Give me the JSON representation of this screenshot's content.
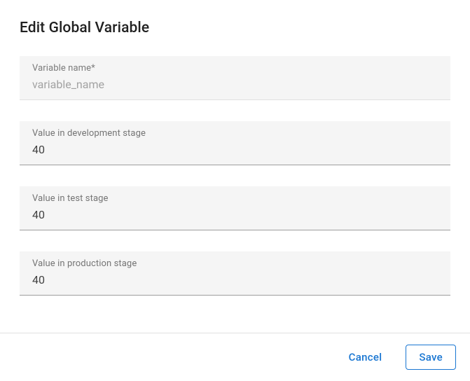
{
  "dialog": {
    "title": "Edit Global Variable"
  },
  "fields": {
    "name": {
      "label": "Variable name*",
      "value": "variable_name"
    },
    "dev": {
      "label": "Value in development stage",
      "value": "40"
    },
    "test": {
      "label": "Value in test stage",
      "value": "40"
    },
    "prod": {
      "label": "Value in production stage",
      "value": "40"
    }
  },
  "actions": {
    "cancel": "Cancel",
    "save": "Save"
  }
}
